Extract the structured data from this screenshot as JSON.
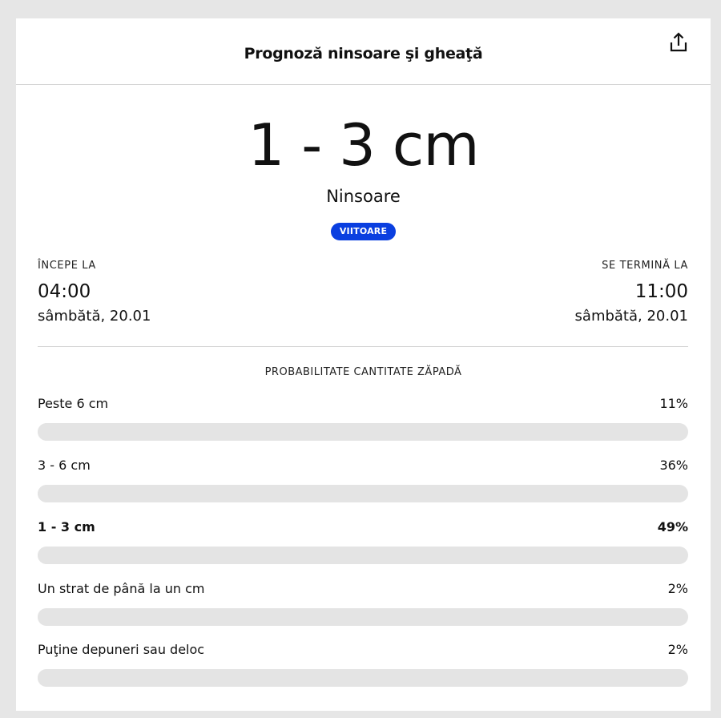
{
  "header": {
    "title": "Prognoză ninsoare şi gheaţă",
    "share_icon": "share-icon"
  },
  "summary": {
    "amount": "1 - 3 cm",
    "kind": "Ninsoare",
    "badge": "VIITOARE",
    "badge_color": "#0a3fe0"
  },
  "start": {
    "label": "ÎNCEPE LA",
    "time": "04:00",
    "date": "sâmbătă, 20.01"
  },
  "end": {
    "label": "SE TERMINĂ LA",
    "time": "11:00",
    "date": "sâmbătă, 20.01"
  },
  "probability": {
    "title": "PROBABILITATE CANTITATE ZĂPADĂ",
    "rows": [
      {
        "label": "Peste 6 cm",
        "percent": "11%",
        "highlighted": false
      },
      {
        "label": "3 - 6 cm",
        "percent": "36%",
        "highlighted": false
      },
      {
        "label": "1 - 3 cm",
        "percent": "49%",
        "highlighted": true
      },
      {
        "label": "Un strat de până la un cm",
        "percent": "2%",
        "highlighted": false
      },
      {
        "label": "Puţine depuneri sau deloc",
        "percent": "2%",
        "highlighted": false
      }
    ]
  },
  "colors": {
    "track": "#e4e4e4",
    "fill": "#e4e4e4"
  }
}
